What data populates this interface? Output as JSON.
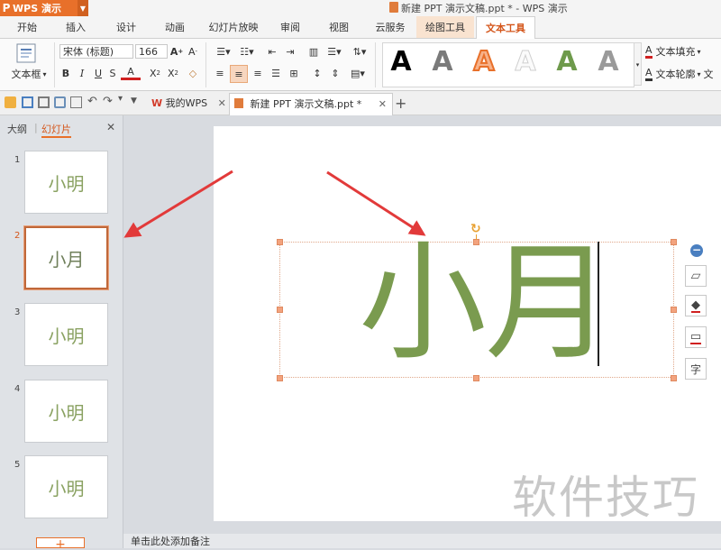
{
  "app": {
    "menu_label": "WPS 演示",
    "window_title": "新建 PPT 演示文稿.ppt * - WPS 演示"
  },
  "menu_tabs": [
    "开始",
    "插入",
    "设计",
    "动画",
    "幻灯片放映",
    "审阅",
    "视图",
    "云服务",
    "绘图工具",
    "文本工具"
  ],
  "ribbon": {
    "textbox_label": "文本框",
    "font_name": "宋体 (标题)",
    "font_size": "166",
    "text_fill_label": "文本填充",
    "text_outline_label": "文本轮廓",
    "text_effect_label": "文",
    "style_letter": "A"
  },
  "doc_tabs": {
    "wps_tab": "我的WPS",
    "doc_tab": "新建 PPT 演示文稿.ppt *",
    "new_tab": "+"
  },
  "panel": {
    "outline_tab": "大纲",
    "slides_tab": "幻灯片"
  },
  "slides": [
    {
      "num": "1",
      "text": "小明"
    },
    {
      "num": "2",
      "text": "小月"
    },
    {
      "num": "3",
      "text": "小明"
    },
    {
      "num": "4",
      "text": "小明"
    },
    {
      "num": "5",
      "text": "小明"
    }
  ],
  "add_slide_label": "+",
  "canvas": {
    "text": "小月"
  },
  "notes_placeholder": "单击此处添加备注",
  "watermark": "软件技巧",
  "colors": {
    "accent": "#e8702a",
    "slide_text": "#7a9b4f",
    "arrow": "#e23a3a"
  }
}
